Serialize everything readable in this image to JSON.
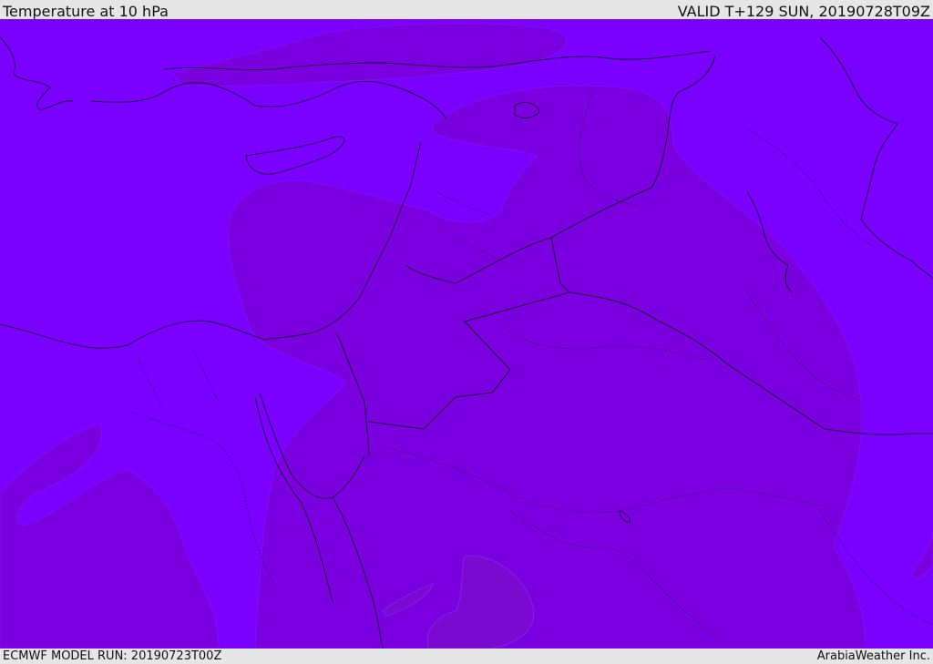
{
  "header": {
    "title": "Temperature at 10 hPa",
    "valid": "VALID T+129 SUN, 20190728T09Z"
  },
  "footer": {
    "model_run": "ECMWF MODEL RUN: 20190723T00Z",
    "credit": "ArabiaWeather Inc."
  },
  "map": {
    "field_colors": {
      "base": "#7a00ff",
      "warmer": "#7b00e0",
      "warmest": "#7a0ad0"
    },
    "line_colors": {
      "coast": "#1a0033",
      "border": "#1a0033"
    }
  }
}
